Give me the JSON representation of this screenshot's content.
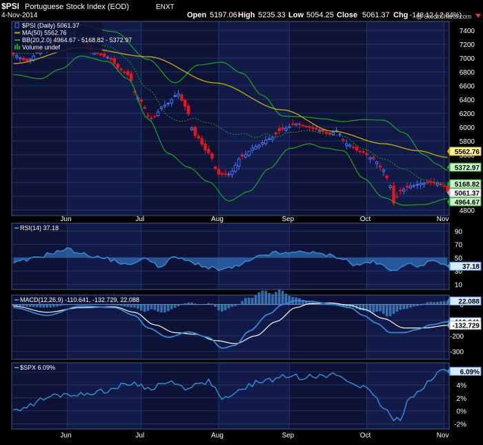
{
  "header": {
    "symbol": "$PSI",
    "name": "Portuguese Stock Index (EOD)",
    "exchange": "ENXT",
    "date": "4-Nov-2014",
    "copyright": "@ StockCharts.com",
    "open_label": "Open",
    "open": "5197.06",
    "high_label": "High",
    "high": "5235.33",
    "low_label": "Low",
    "low": "5054.25",
    "close_label": "Close",
    "close": "5061.37",
    "chg_label": "Chg",
    "chg": "-148.12 (-2.84%)"
  },
  "colors": {
    "background": "#000000",
    "panel": "#0d1236",
    "grid": "#1f3a6a",
    "up_candle": "#4a78ff",
    "down_candle": "#e8141e",
    "ma": "#c8b400",
    "bb": "#1eaa1e",
    "bb_mid": "#1eaa1e",
    "indicator": "#3a8ad8",
    "signal": "#ffffff",
    "hist": "#3f7fc0",
    "text": "#ffffff",
    "chg_negative": "#ff3030"
  },
  "chart_data": [
    {
      "type": "candlestick",
      "panel": "price",
      "legend": [
        {
          "label": "$PSI (Daily) 5061.37"
        },
        {
          "label": "MA(50) 5562.76"
        },
        {
          "label": "BB(20,2.0) 4964.67 - 5168.82 - 5372.97"
        },
        {
          "label": "Volume undef"
        }
      ],
      "months": [
        {
          "label": "Jun",
          "index": 16
        },
        {
          "label": "Jul",
          "index": 38
        },
        {
          "label": "Aug",
          "index": 61
        },
        {
          "label": "Sep",
          "index": 82
        },
        {
          "label": "Oct",
          "index": 105
        },
        {
          "label": "Nov",
          "index": 128
        }
      ],
      "y_ticks": [
        4800,
        5000,
        5200,
        5400,
        5600,
        5800,
        6000,
        6200,
        6400,
        6600,
        6800,
        7000,
        7200,
        7400
      ],
      "ylim": [
        4720,
        7530
      ],
      "close_anchors": [
        [
          0,
          7050
        ],
        [
          4,
          6960
        ],
        [
          8,
          7100
        ],
        [
          12,
          7250
        ],
        [
          16,
          7380
        ],
        [
          20,
          7280
        ],
        [
          24,
          7080
        ],
        [
          28,
          7010
        ],
        [
          32,
          6830
        ],
        [
          34,
          6760
        ],
        [
          37,
          6420
        ],
        [
          41,
          6120
        ],
        [
          45,
          6320
        ],
        [
          49,
          6480
        ],
        [
          51,
          6300
        ],
        [
          54,
          5880
        ],
        [
          58,
          5630
        ],
        [
          61,
          5320
        ],
        [
          64,
          5320
        ],
        [
          68,
          5580
        ],
        [
          72,
          5720
        ],
        [
          76,
          5830
        ],
        [
          80,
          5970
        ],
        [
          84,
          6050
        ],
        [
          86,
          6020
        ],
        [
          90,
          5970
        ],
        [
          94,
          5900
        ],
        [
          96,
          5950
        ],
        [
          99,
          5760
        ],
        [
          103,
          5650
        ],
        [
          107,
          5540
        ],
        [
          110,
          5380
        ],
        [
          112,
          5150
        ],
        [
          113,
          4900
        ],
        [
          115,
          5080
        ],
        [
          118,
          5150
        ],
        [
          122,
          5190
        ],
        [
          125,
          5200
        ],
        [
          128,
          5150
        ],
        [
          129,
          5061.37
        ]
      ],
      "ma50_anchors": [
        [
          0,
          6920
        ],
        [
          20,
          7150
        ],
        [
          40,
          7020
        ],
        [
          60,
          6640
        ],
        [
          80,
          6250
        ],
        [
          95,
          5940
        ],
        [
          110,
          5760
        ],
        [
          120,
          5660
        ],
        [
          129,
          5562.76
        ]
      ],
      "bb_upper_anchors": [
        [
          0,
          7380
        ],
        [
          12,
          7460
        ],
        [
          20,
          7480
        ],
        [
          30,
          7380
        ],
        [
          40,
          6980
        ],
        [
          48,
          6640
        ],
        [
          55,
          6900
        ],
        [
          62,
          6940
        ],
        [
          68,
          6780
        ],
        [
          74,
          6460
        ],
        [
          80,
          6160
        ],
        [
          86,
          6150
        ],
        [
          92,
          6120
        ],
        [
          98,
          6080
        ],
        [
          104,
          6110
        ],
        [
          110,
          6100
        ],
        [
          116,
          5920
        ],
        [
          122,
          5600
        ],
        [
          126,
          5460
        ],
        [
          129,
          5372.97
        ]
      ],
      "bb_lower_anchors": [
        [
          0,
          6760
        ],
        [
          8,
          6700
        ],
        [
          14,
          6840
        ],
        [
          20,
          7030
        ],
        [
          28,
          6950
        ],
        [
          34,
          6700
        ],
        [
          40,
          6120
        ],
        [
          46,
          5620
        ],
        [
          52,
          5420
        ],
        [
          58,
          5210
        ],
        [
          64,
          4930
        ],
        [
          70,
          5070
        ],
        [
          76,
          5400
        ],
        [
          82,
          5690
        ],
        [
          88,
          5760
        ],
        [
          92,
          5700
        ],
        [
          98,
          5660
        ],
        [
          104,
          5260
        ],
        [
          110,
          4980
        ],
        [
          116,
          4870
        ],
        [
          122,
          4880
        ],
        [
          129,
          4964.67
        ]
      ],
      "price_labels": [
        {
          "value": "5562.76",
          "style": "yellow"
        },
        {
          "value": "5372.97",
          "style": "green"
        },
        {
          "value": "5168.82",
          "style": "green"
        },
        {
          "value": "5061.37",
          "style": "close"
        },
        {
          "value": "4964.67",
          "style": "green"
        }
      ]
    },
    {
      "type": "line",
      "panel": "rsi",
      "label": "RSI(14) 37.18",
      "y_ticks": [
        10,
        30,
        50,
        70,
        90
      ],
      "ylim": [
        2,
        102
      ],
      "centerline": 50,
      "anchors": [
        [
          0,
          42
        ],
        [
          4,
          46
        ],
        [
          8,
          52
        ],
        [
          12,
          58
        ],
        [
          16,
          63
        ],
        [
          18,
          60
        ],
        [
          22,
          54
        ],
        [
          26,
          50
        ],
        [
          30,
          46
        ],
        [
          34,
          38
        ],
        [
          36,
          44
        ],
        [
          40,
          48
        ],
        [
          44,
          36
        ],
        [
          48,
          52
        ],
        [
          50,
          47
        ],
        [
          54,
          42
        ],
        [
          58,
          34
        ],
        [
          62,
          32
        ],
        [
          66,
          36
        ],
        [
          70,
          44
        ],
        [
          74,
          54
        ],
        [
          78,
          57
        ],
        [
          82,
          56
        ],
        [
          86,
          61
        ],
        [
          88,
          57
        ],
        [
          92,
          55
        ],
        [
          96,
          52
        ],
        [
          98,
          48
        ],
        [
          102,
          38
        ],
        [
          106,
          44
        ],
        [
          109,
          40
        ],
        [
          112,
          30
        ],
        [
          114,
          34
        ],
        [
          116,
          40
        ],
        [
          120,
          38
        ],
        [
          124,
          44
        ],
        [
          127,
          40
        ],
        [
          129,
          37.18
        ]
      ],
      "value_label": "37.18"
    },
    {
      "type": "line",
      "panel": "macd",
      "label": "MACD(12,26,9) -110.641, -132.729, 22.088",
      "y_ticks": [
        -300,
        -200,
        -100,
        0
      ],
      "ylim": [
        -350,
        60
      ],
      "macd_anchors": [
        [
          0,
          -20
        ],
        [
          10,
          -70
        ],
        [
          20,
          -10
        ],
        [
          30,
          -20
        ],
        [
          36,
          -70
        ],
        [
          40,
          -150
        ],
        [
          46,
          -210
        ],
        [
          52,
          -175
        ],
        [
          58,
          -210
        ],
        [
          62,
          -280
        ],
        [
          66,
          -260
        ],
        [
          70,
          -170
        ],
        [
          76,
          -60
        ],
        [
          80,
          0
        ],
        [
          84,
          25
        ],
        [
          88,
          20
        ],
        [
          94,
          5
        ],
        [
          100,
          -20
        ],
        [
          104,
          -70
        ],
        [
          108,
          -120
        ],
        [
          112,
          -180
        ],
        [
          116,
          -180
        ],
        [
          120,
          -160
        ],
        [
          124,
          -130
        ],
        [
          129,
          -110.641
        ]
      ],
      "signal_anchors": [
        [
          0,
          -10
        ],
        [
          10,
          -50
        ],
        [
          20,
          -20
        ],
        [
          30,
          -15
        ],
        [
          36,
          -50
        ],
        [
          42,
          -130
        ],
        [
          48,
          -180
        ],
        [
          54,
          -190
        ],
        [
          60,
          -230
        ],
        [
          66,
          -250
        ],
        [
          72,
          -200
        ],
        [
          78,
          -110
        ],
        [
          84,
          -20
        ],
        [
          88,
          5
        ],
        [
          94,
          10
        ],
        [
          100,
          -5
        ],
        [
          104,
          -30
        ],
        [
          110,
          -90
        ],
        [
          116,
          -150
        ],
        [
          122,
          -150
        ],
        [
          129,
          -132.729
        ]
      ],
      "value_labels": [
        {
          "value": "22.088"
        },
        {
          "value": "-110.641"
        },
        {
          "value": "-132.729"
        }
      ]
    },
    {
      "type": "line",
      "panel": "spx",
      "label": "$SPX 6.09%",
      "y_ticks": [
        "-2%",
        "0%",
        "2%",
        "4%",
        "6%"
      ],
      "ylim": [
        -2.8,
        7.4
      ],
      "unit": "%",
      "anchors": [
        [
          0,
          0.2
        ],
        [
          4,
          0.6
        ],
        [
          8,
          1.6
        ],
        [
          12,
          2.3
        ],
        [
          16,
          2.6
        ],
        [
          20,
          2.4
        ],
        [
          24,
          2.9
        ],
        [
          28,
          3.2
        ],
        [
          32,
          3.8
        ],
        [
          36,
          4.3
        ],
        [
          40,
          3.4
        ],
        [
          44,
          4.1
        ],
        [
          48,
          4.5
        ],
        [
          50,
          3.6
        ],
        [
          54,
          3.9
        ],
        [
          58,
          4.6
        ],
        [
          62,
          1.9
        ],
        [
          64,
          1.7
        ],
        [
          66,
          2.8
        ],
        [
          70,
          3.9
        ],
        [
          74,
          4.6
        ],
        [
          78,
          4.9
        ],
        [
          82,
          5.4
        ],
        [
          86,
          5.2
        ],
        [
          88,
          5.7
        ],
        [
          92,
          5.2
        ],
        [
          96,
          5.6
        ],
        [
          100,
          4.4
        ],
        [
          104,
          3.8
        ],
        [
          106,
          2.7
        ],
        [
          108,
          1.6
        ],
        [
          110,
          0.5
        ],
        [
          112,
          -0.7
        ],
        [
          113,
          -1.6
        ],
        [
          115,
          -1.2
        ],
        [
          117,
          1.4
        ],
        [
          119,
          2.6
        ],
        [
          121,
          3.4
        ],
        [
          123,
          4.4
        ],
        [
          125,
          5.1
        ],
        [
          127,
          6.2
        ],
        [
          129,
          6.09
        ]
      ],
      "value_label": "6.09%"
    }
  ]
}
